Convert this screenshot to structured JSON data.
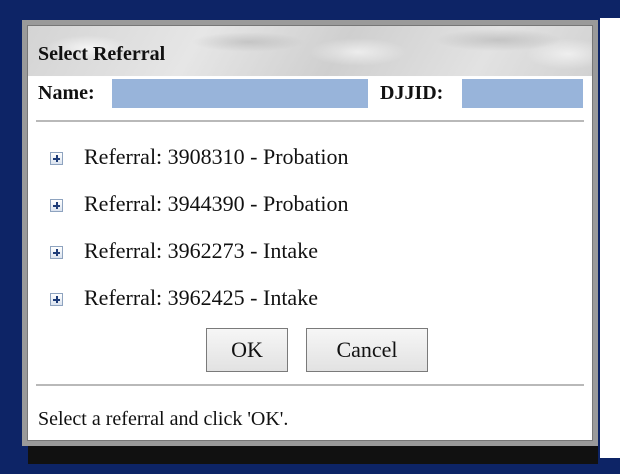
{
  "dialog": {
    "title": "Select Referral",
    "name_label": "Name:",
    "name_value": "",
    "djjid_label": "DJJID:",
    "djjid_value": "",
    "referrals": [
      {
        "label": "Referral: 3908310 - Probation"
      },
      {
        "label": "Referral: 3944390 - Probation"
      },
      {
        "label": "Referral: 3962273 - Intake"
      },
      {
        "label": "Referral: 3962425 - Intake"
      }
    ],
    "ok_label": "OK",
    "cancel_label": "Cancel",
    "status_text": "Select a referral and click 'OK'.",
    "colors": {
      "redacted_field": "#98b4da",
      "background": "#0d2466"
    },
    "icons": {
      "expander": "plus-box-icon"
    }
  }
}
